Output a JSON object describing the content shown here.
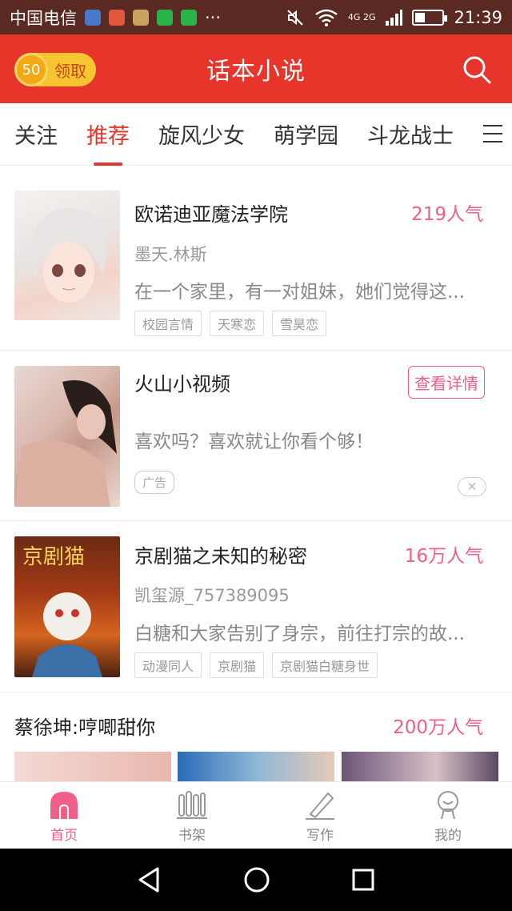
{
  "status_bar": {
    "carrier": "中国电信",
    "network": "4G 2G",
    "time": "21:39",
    "battery_level": 0.35
  },
  "header": {
    "coin_count": "50",
    "coin_label": "领取",
    "title": "话本小说"
  },
  "tabs": [
    {
      "label": "关注",
      "active": false
    },
    {
      "label": "推荐",
      "active": true
    },
    {
      "label": "旋风少女",
      "active": false
    },
    {
      "label": "萌学园",
      "active": false
    },
    {
      "label": "斗龙战士",
      "active": false
    }
  ],
  "feed": {
    "card1": {
      "title": "欧诺迪亚魔法学院",
      "popularity": "219人气",
      "author": "墨天.林斯",
      "description": "在一个家里，有一对姐妹，她们觉得这...",
      "tags": [
        "校园言情",
        "天寒恋",
        "雪昊恋"
      ]
    },
    "ad": {
      "title": "火山小视频",
      "button": "查看详情",
      "description": "喜欢吗？喜欢就让你看个够！",
      "badge": "广告"
    },
    "card2": {
      "title": "京剧猫之未知的秘密",
      "popularity": "16万人气",
      "author": "凯玺源_757389095",
      "description": "白糖和大家告别了身宗，前往打宗的故...",
      "tags": [
        "动漫同人",
        "京剧猫",
        "京剧猫白糖身世"
      ]
    },
    "card3": {
      "title": "蔡徐坤:哼唧甜你",
      "popularity": "200万人气"
    }
  },
  "bottom_nav": [
    {
      "label": "首页",
      "icon": "home-icon",
      "active": true
    },
    {
      "label": "书架",
      "icon": "bookshelf-icon",
      "active": false
    },
    {
      "label": "写作",
      "icon": "pen-icon",
      "active": false
    },
    {
      "label": "我的",
      "icon": "profile-icon",
      "active": false
    }
  ],
  "colors": {
    "header": "#e8352b",
    "accent_pink": "#ef5f8a",
    "active_tab": "#e0362c",
    "coin": "#f7c532"
  }
}
